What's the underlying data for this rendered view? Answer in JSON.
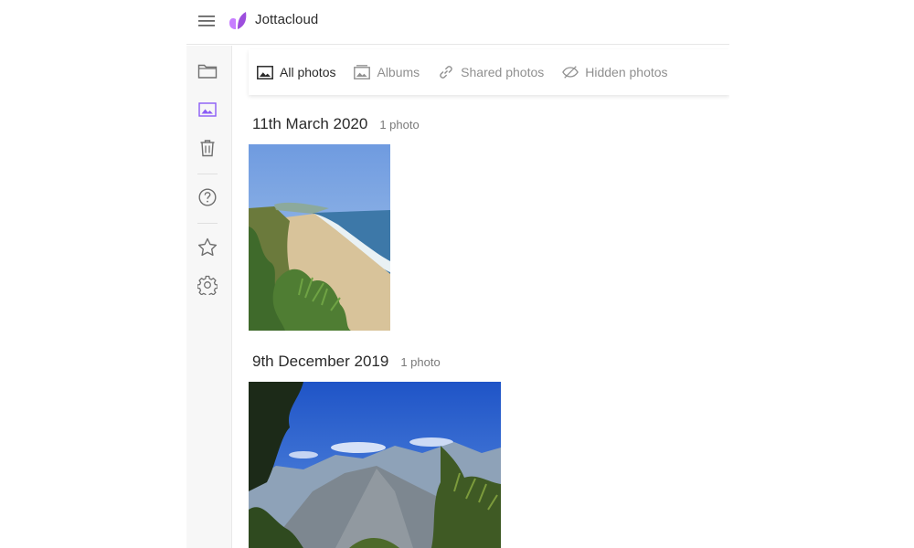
{
  "app": {
    "brand": "Jottacloud",
    "accent": "#8b5cf6"
  },
  "sidebar": {
    "items": [
      {
        "name": "files",
        "icon": "folder-icon",
        "active": false
      },
      {
        "name": "photos",
        "icon": "photo-icon",
        "active": true
      },
      {
        "name": "trash",
        "icon": "trash-icon",
        "active": false
      },
      {
        "name": "help",
        "icon": "help-icon",
        "active": false
      },
      {
        "name": "favorites",
        "icon": "star-icon",
        "active": false
      },
      {
        "name": "settings",
        "icon": "gear-icon",
        "active": false
      }
    ]
  },
  "tabs": [
    {
      "label": "All photos",
      "icon": "image-icon",
      "active": true
    },
    {
      "label": "Albums",
      "icon": "album-icon",
      "active": false
    },
    {
      "label": "Shared photos",
      "icon": "link-icon",
      "active": false
    },
    {
      "label": "Hidden photos",
      "icon": "eye-off-icon",
      "active": false
    }
  ],
  "groups": [
    {
      "date": "11th March 2020",
      "count": "1 photo",
      "photo": "beach-cliff-photo"
    },
    {
      "date": "9th December 2019",
      "count": "1 photo",
      "photo": "mountain-valley-photo"
    }
  ]
}
